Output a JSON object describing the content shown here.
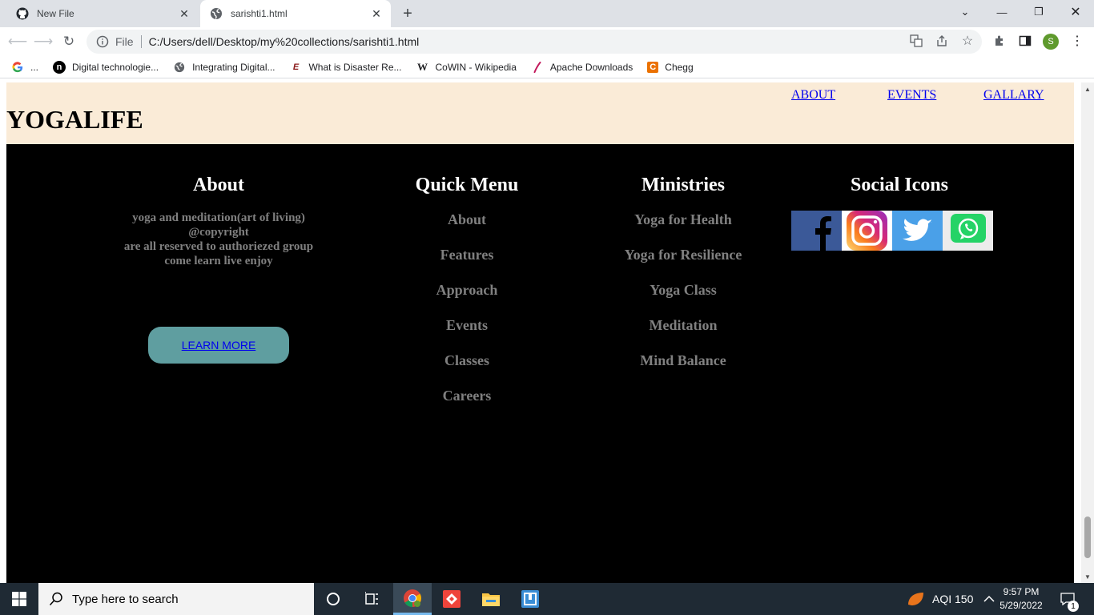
{
  "browser": {
    "tabs": [
      {
        "title": "New File",
        "icon": "github-icon",
        "active": false
      },
      {
        "title": "sarishti1.html",
        "icon": "globe-icon",
        "active": true
      }
    ],
    "address": {
      "scheme": "File",
      "url": "C:/Users/dell/Desktop/my%20collections/sarishti1.html"
    },
    "profile_initial": "S",
    "bookmarks": [
      {
        "label": "...",
        "icon": "google-icon"
      },
      {
        "label": "Digital technologie...",
        "icon": "n-logo-icon"
      },
      {
        "label": "Integrating Digital...",
        "icon": "globe-icon"
      },
      {
        "label": "What is Disaster Re...",
        "icon": "e-logo-icon"
      },
      {
        "label": "CoWIN - Wikipedia",
        "icon": "wikipedia-icon"
      },
      {
        "label": "Apache Downloads",
        "icon": "apache-feather-icon"
      },
      {
        "label": "Chegg",
        "icon": "chegg-icon"
      }
    ]
  },
  "page": {
    "brand": "YOGALIFE",
    "nav": [
      "ABOUT",
      "EVENTS",
      "GALLARY"
    ],
    "footer": {
      "about": {
        "heading": "About",
        "lines": [
          "yoga and meditation(art of living)",
          "@copyright",
          "are all reserved to authoriezed group",
          "come learn live enjoy"
        ],
        "button": "LEARN MORE"
      },
      "quick_menu": {
        "heading": "Quick Menu",
        "items": [
          "About",
          "Features",
          "Approach",
          "Events",
          "Classes",
          "Careers"
        ]
      },
      "ministries": {
        "heading": "Ministries",
        "items": [
          "Yoga for Health",
          "Yoga for Resilience",
          "Yoga Class",
          "Meditation",
          "Mind Balance"
        ]
      },
      "social": {
        "heading": "Social Icons",
        "icons": [
          "facebook-icon",
          "instagram-icon",
          "twitter-icon",
          "whatsapp-icon"
        ]
      }
    }
  },
  "taskbar": {
    "search_placeholder": "Type here to search",
    "aqi": "AQI 150",
    "time": "9:57 PM",
    "date": "5/29/2022",
    "notification_count": "1"
  },
  "colors": {
    "header_bg": "#faebd7",
    "footer_bg": "#000000",
    "muted_text": "#808080",
    "button_bg": "#5f9ea0",
    "link": "#0000ee"
  }
}
